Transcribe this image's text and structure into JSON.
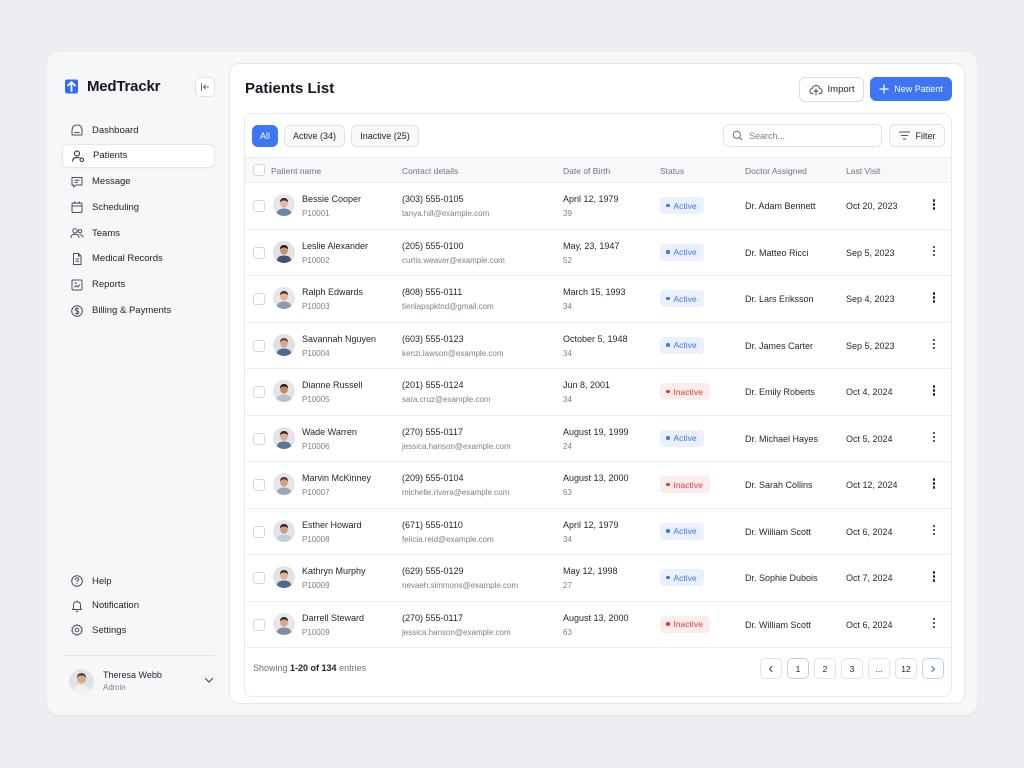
{
  "app": {
    "name": "MedTrackr"
  },
  "sidebar": {
    "items": [
      {
        "label": "Dashboard",
        "icon": "dashboard-icon",
        "active": false
      },
      {
        "label": "Patients",
        "icon": "patients-icon",
        "active": true
      },
      {
        "label": "Message",
        "icon": "message-icon",
        "active": false
      },
      {
        "label": "Scheduling",
        "icon": "calendar-icon",
        "active": false
      },
      {
        "label": "Teams",
        "icon": "teams-icon",
        "active": false
      },
      {
        "label": "Medical Records",
        "icon": "records-icon",
        "active": false
      },
      {
        "label": "Reports",
        "icon": "reports-icon",
        "active": false
      },
      {
        "label": "Billing & Payments",
        "icon": "billing-icon",
        "active": false
      }
    ],
    "bottom_items": [
      {
        "label": "Help",
        "icon": "help-icon"
      },
      {
        "label": "Notification",
        "icon": "bell-icon"
      },
      {
        "label": "Settings",
        "icon": "gear-icon"
      }
    ],
    "user": {
      "name": "Theresa Webb",
      "role": "Admin"
    }
  },
  "page": {
    "title": "Patients List",
    "import_label": "Import",
    "new_label": "New Patient"
  },
  "filters": {
    "tabs": [
      {
        "label": "All",
        "active": true
      },
      {
        "label": "Active (34)",
        "active": false
      },
      {
        "label": "Inactive (25)",
        "active": false
      }
    ],
    "search_placeholder": "Search...",
    "filter_label": "Filter"
  },
  "table": {
    "columns": [
      "Patient name",
      "Contact details",
      "Date of Birth",
      "Status",
      "Doctor Assigned",
      "Last Visit"
    ],
    "rows": [
      {
        "name": "Bessie Cooper",
        "id": "P10001",
        "phone": "(303) 555-0105",
        "email": "tanya.hill@example.com",
        "dob": "April 12, 1979",
        "age": "39",
        "status": "Active",
        "doctor": "Dr. Adam Bennett",
        "last_visit": "Oct 20, 2023"
      },
      {
        "name": "Leslie Alexander",
        "id": "P10002",
        "phone": "(205) 555-0100",
        "email": "curtis.weaver@example.com",
        "dob": "May, 23, 1947",
        "age": "52",
        "status": "Active",
        "doctor": "Dr. Matteo Ricci",
        "last_visit": "Sep 5, 2023"
      },
      {
        "name": "Ralph Edwards",
        "id": "P10003",
        "phone": "(808) 555-0111",
        "email": "tienlapspktnd@gmail.com",
        "dob": "March 15, 1993",
        "age": "34",
        "status": "Active",
        "doctor": "Dr. Lars Eriksson",
        "last_visit": "Sep 4, 2023"
      },
      {
        "name": "Savannah Nguyen",
        "id": "P10004",
        "phone": "(603) 555-0123",
        "email": "kenzi.lawson@example.com",
        "dob": "October 5, 1948",
        "age": "34",
        "status": "Active",
        "doctor": "Dr. James Carter",
        "last_visit": "Sep 5, 2023"
      },
      {
        "name": "Dianne Russell",
        "id": "P10005",
        "phone": "(201) 555-0124",
        "email": "sara.cruz@example.com",
        "dob": "Jun 8, 2001",
        "age": "34",
        "status": "Inactive",
        "doctor": "Dr. Emily Roberts",
        "last_visit": "Oct 4, 2024"
      },
      {
        "name": "Wade Warren",
        "id": "P10006",
        "phone": "(270) 555-0117",
        "email": "jessica.hanson@example.com",
        "dob": "August 19, 1999",
        "age": "24",
        "status": "Active",
        "doctor": "Dr. Michael Hayes",
        "last_visit": "Oct 5, 2024"
      },
      {
        "name": "Marvin McKinney",
        "id": "P10007",
        "phone": "(209) 555-0104",
        "email": "michelle.rivera@example.com",
        "dob": "August 13, 2000",
        "age": "63",
        "status": "Inactive",
        "doctor": "Dr. Sarah Collins",
        "last_visit": "Oct 12, 2024"
      },
      {
        "name": "Esther Howard",
        "id": "P10008",
        "phone": "(671) 555-0110",
        "email": "felicia.reid@example.com",
        "dob": "April 12, 1979",
        "age": "34",
        "status": "Active",
        "doctor": "Dr. William Scott",
        "last_visit": "Oct 6, 2024"
      },
      {
        "name": "Kathryn Murphy",
        "id": "P10009",
        "phone": "(629) 555-0129",
        "email": "nevaeh.simmons@example.com",
        "dob": "May 12, 1998",
        "age": "27",
        "status": "Active",
        "doctor": "Dr. Sophie Dubois",
        "last_visit": "Oct 7, 2024"
      },
      {
        "name": "Darrell Steward",
        "id": "P10009",
        "phone": "(270) 555-0117",
        "email": "jessica.hanson@example.com",
        "dob": "August 13, 2000",
        "age": "63",
        "status": "Inactive",
        "doctor": "Dr. William Scott",
        "last_visit": "Oct 6, 2024"
      }
    ]
  },
  "footer": {
    "prefix": "Showing ",
    "range": "1-20 of 134",
    "suffix": " entries",
    "pages": [
      "1",
      "2",
      "3",
      "...",
      "12"
    ],
    "current_page": "1"
  },
  "colors": {
    "accent": "#3d75f2",
    "active_bg": "#eaf0fe",
    "inactive_text": "#e0383e",
    "inactive_bg": "#fdecec"
  }
}
